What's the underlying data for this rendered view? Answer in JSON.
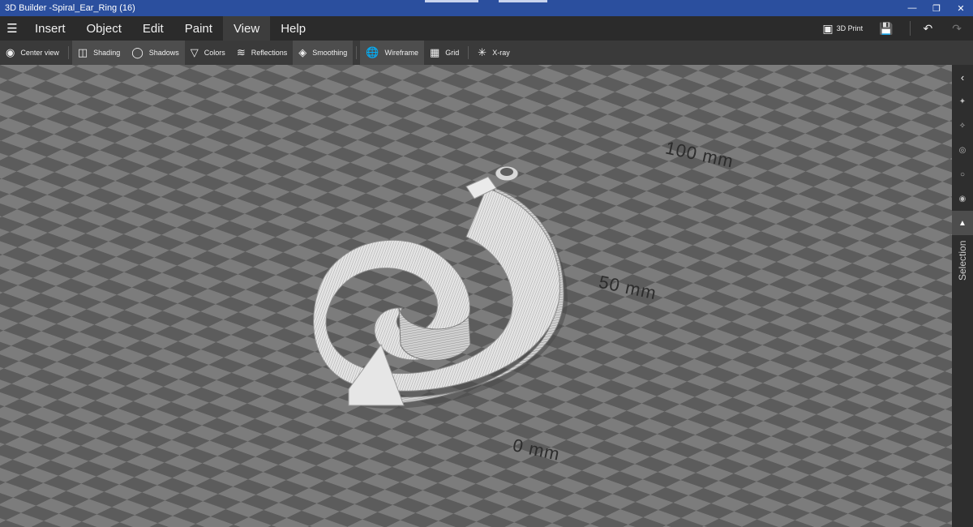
{
  "window": {
    "title": "3D Builder -Spiral_Ear_Ring (16)"
  },
  "menu": {
    "items": [
      {
        "label": "Insert",
        "active": false
      },
      {
        "label": "Object",
        "active": false
      },
      {
        "label": "Edit",
        "active": false
      },
      {
        "label": "Paint",
        "active": false
      },
      {
        "label": "View",
        "active": true
      },
      {
        "label": "Help",
        "active": false
      }
    ],
    "print_label": "3D Print"
  },
  "toolbar": {
    "center_view": "Center view",
    "shading": "Shading",
    "shadows": "Shadows",
    "colors": "Colors",
    "reflections": "Reflections",
    "smoothing": "Smoothing",
    "wireframe": "Wireframe",
    "grid": "Grid",
    "xray": "X-ray"
  },
  "viewport": {
    "labels": {
      "mm100": "100 mm",
      "mm50": "50 mm",
      "mm0": "0 mm"
    },
    "model_name": "Spiral_Ear_Ring"
  },
  "side_panel": {
    "label": "Selection"
  },
  "colors": {
    "titlebar": "#2b4f9e",
    "menubar": "#2b2b2b",
    "toolbar": "#3a3a3a",
    "toggle_on": "#4d4d4d",
    "checker_dark": "#5c5c5c",
    "checker_light": "#7c7c7c",
    "model": "#dcdcdc"
  },
  "icons": {
    "menu": "hamburger-icon",
    "print": "printer-icon",
    "save": "save-icon",
    "undo": "undo-icon",
    "redo": "redo-icon"
  }
}
